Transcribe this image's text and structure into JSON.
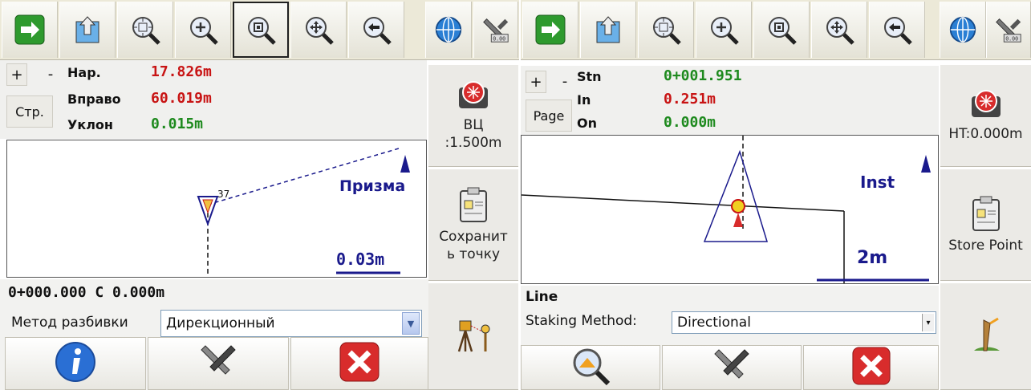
{
  "left": {
    "toolbar": [
      "next-icon",
      "map-up-icon",
      "zoom-extents-icon",
      "zoom-in-icon",
      "zoom-window-icon",
      "pan-icon",
      "zoom-previous-icon",
      "globe-icon",
      "settings-icon"
    ],
    "plus": "+",
    "minus": "-",
    "page_label": "Стр.",
    "rows": [
      {
        "label": "Нар.",
        "value": "17.826m"
      },
      {
        "label": "Вправо",
        "value": "60.019m"
      },
      {
        "label": "Уклон",
        "value": "0.015m"
      }
    ],
    "map": {
      "point_label": "37",
      "target_label": "Призма",
      "scale": "0.03m"
    },
    "side": {
      "ht_label": "ВЦ\n:1.500m",
      "store_label": "Сохранит\nь точку"
    },
    "station_line": "0+000.000 C 0.000m",
    "method_label": "Метод разбивки",
    "method_value": "Дирекционный",
    "bottom_buttons": [
      "info-icon",
      "tools-icon",
      "close-icon"
    ]
  },
  "right": {
    "toolbar": [
      "next-icon",
      "map-up-icon",
      "zoom-extents-icon",
      "zoom-in-icon",
      "zoom-window-icon",
      "pan-icon",
      "zoom-previous-icon",
      "globe-icon",
      "settings-icon"
    ],
    "plus": "+",
    "minus": "-",
    "page_label": "Page",
    "rows": [
      {
        "label": "Stn",
        "value": "0+001.951"
      },
      {
        "label": "In",
        "value": "0.251m"
      },
      {
        "label": "On",
        "value": "0.000m"
      }
    ],
    "map": {
      "target_label": "Inst",
      "scale": "2m"
    },
    "side": {
      "ht_label": "HT:0.000m",
      "store_label": "Store Point"
    },
    "line_label": "Line",
    "method_label": "Staking Method:",
    "method_value": "Directional",
    "bottom_buttons": [
      "search-map-icon",
      "tools-icon",
      "close-icon"
    ]
  },
  "colors": {
    "red": "#c81414",
    "green": "#1e8a1e",
    "navy": "#1a1a8c"
  }
}
